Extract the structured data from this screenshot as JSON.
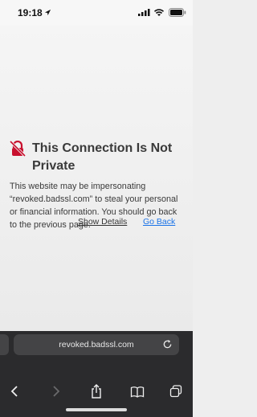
{
  "status_bar": {
    "time": "19:18"
  },
  "error_page": {
    "title": "This Connection Is Not Private",
    "body": "This website may be impersonating “revoked.badssl.com” to steal your personal or financial information. You should go back to the previous page.",
    "show_details_label": "Show Details",
    "go_back_label": "Go Back",
    "link_color": "#1a73e8"
  },
  "toolbar": {
    "url": "revoked.badssl.com",
    "icons": [
      "back-icon",
      "forward-icon",
      "share-icon",
      "bookmarks-icon",
      "tabs-icon",
      "reload-icon"
    ]
  }
}
